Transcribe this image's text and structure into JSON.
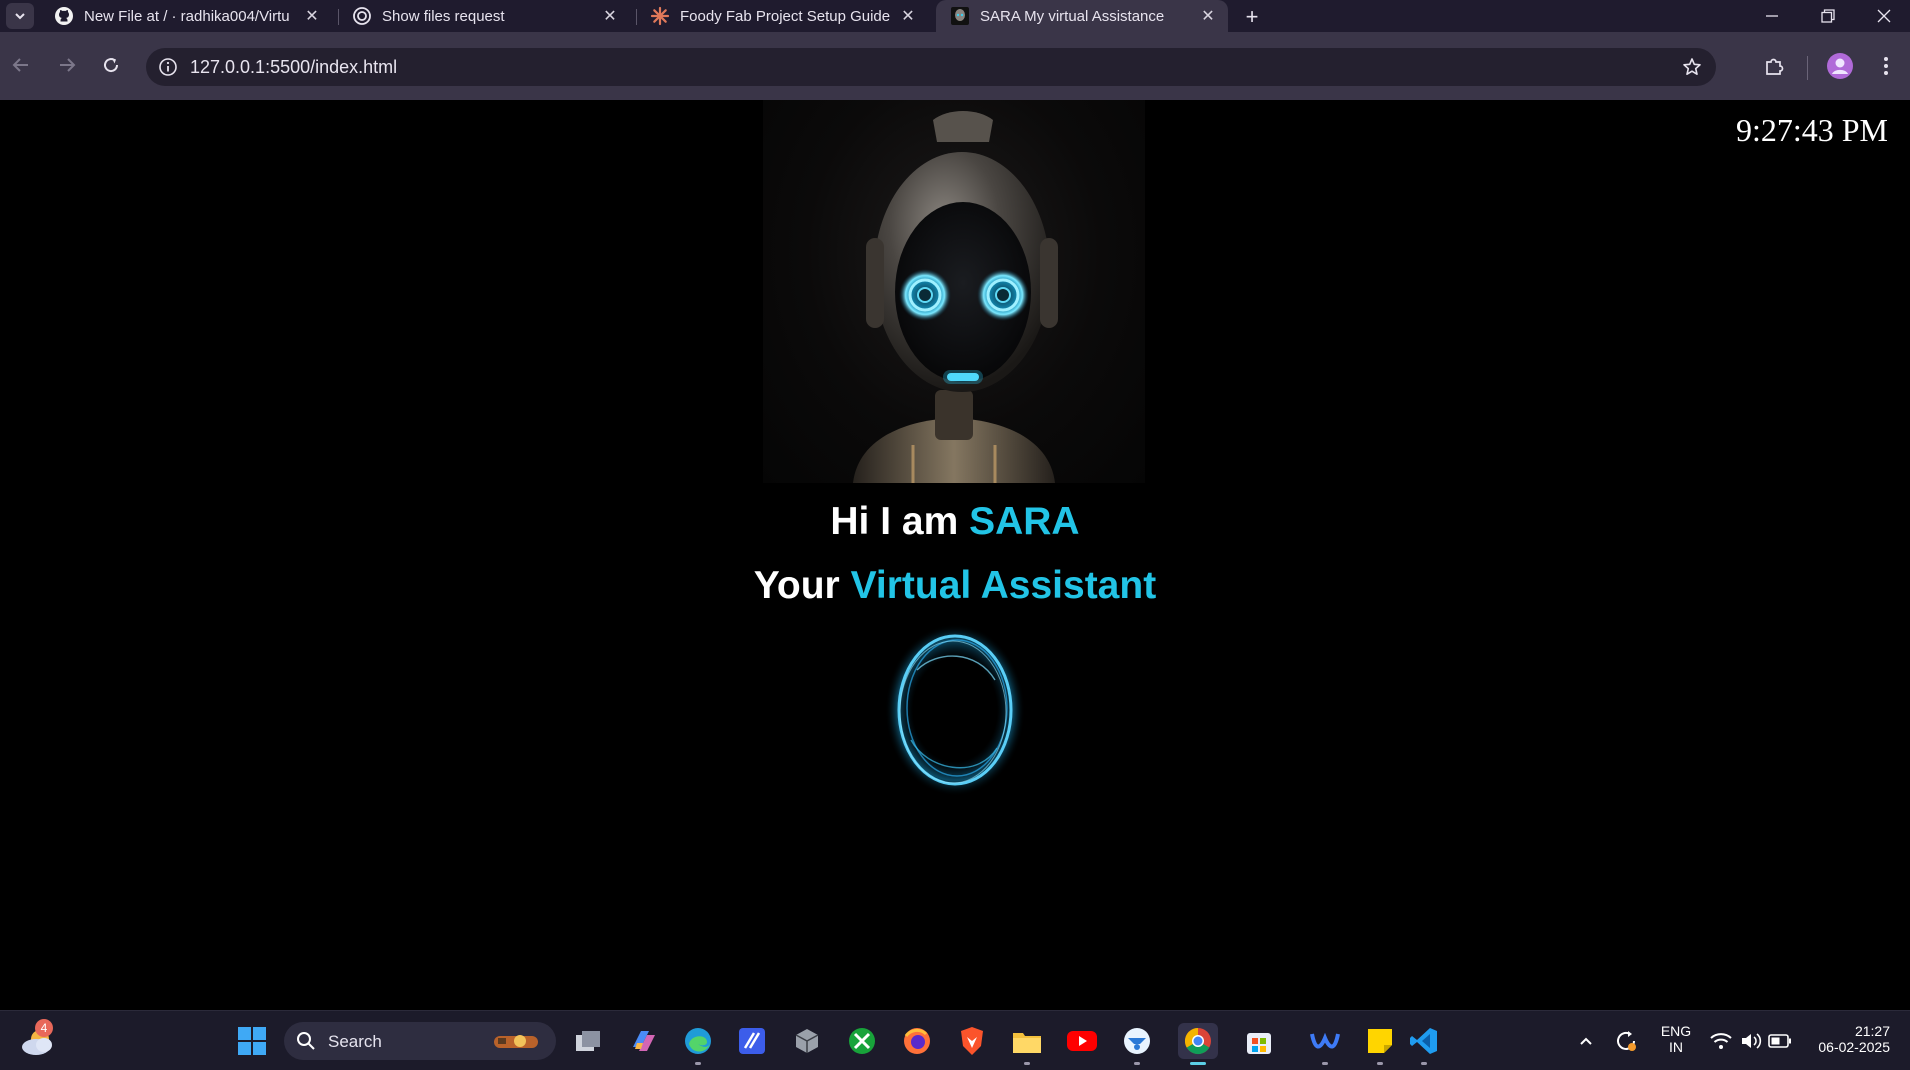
{
  "browser": {
    "tabs": [
      {
        "title": "New File at / · radhika004/Virtu",
        "icon": "github-icon",
        "active": false
      },
      {
        "title": "Show files request",
        "icon": "openai-icon",
        "active": false
      },
      {
        "title": "Foody Fab Project Setup Guide",
        "icon": "claude-icon",
        "active": false
      },
      {
        "title": "SARA My virtual Assistance",
        "icon": "robot-favicon",
        "active": true
      }
    ],
    "address": "127.0.0.1:5500/index.html"
  },
  "page": {
    "clock": "9:27:43 PM",
    "greeting_prefix": "Hi I am ",
    "greeting_name": "SARA",
    "subtitle_prefix": "Your ",
    "subtitle_accent": "Virtual Assistant",
    "accent_color": "#22c4e6"
  },
  "taskbar": {
    "weather_badge": "4",
    "search_placeholder": "Search",
    "apps": [
      "file-explorer-view",
      "copilot",
      "edge",
      "pen-app",
      "settings-cube",
      "xbox",
      "firefox",
      "brave",
      "file-explorer",
      "youtube",
      "browser-fox",
      "chrome",
      "ms-store",
      "webex",
      "sticky-notes",
      "vscode"
    ],
    "lang_top": "ENG",
    "lang_bottom": "IN",
    "time": "21:27",
    "date": "06-02-2025"
  }
}
